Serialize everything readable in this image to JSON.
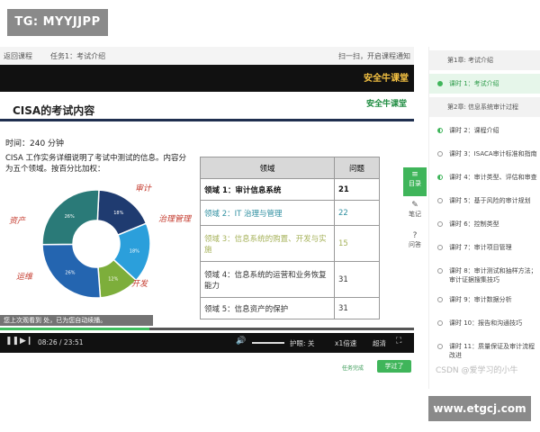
{
  "watermarks": {
    "top": "TG: MYYJJPP",
    "bottom": "www.etgcj.com",
    "csdn": "CSDN @爱学习的小牛"
  },
  "topbar": {
    "back": "返回课程",
    "task": "任务1：考试介绍",
    "scan": "扫一扫，开启课程通知"
  },
  "video": {
    "logo": "安全牛课堂",
    "slide": {
      "title": "CISA的考试内容",
      "logo": "安全牛课堂",
      "duration": "时间：240 分钟",
      "description": "CISA 工作实务详细说明了考试中测试的信息。内容分为五个领域。按百分比加权：",
      "donut": {
        "slices": [
          {
            "label": "18%",
            "value": 18,
            "color": "#1f3b70"
          },
          {
            "label": "18%",
            "value": 18,
            "color": "#2b9fdb"
          },
          {
            "label": "12%",
            "value": 12,
            "color": "#7dae3b"
          },
          {
            "label": "26%",
            "value": 26,
            "color": "#2465b0"
          },
          {
            "label": "26%",
            "value": 26,
            "color": "#2a7a78"
          }
        ]
      },
      "handwriting": [
        "审计",
        "治理管理",
        "开发",
        "运维",
        "资产"
      ],
      "table": {
        "headers": [
          "领域",
          "问题"
        ],
        "rows": [
          {
            "domain": "领域 1：审计信息系统",
            "count": "21"
          },
          {
            "domain": "领域 2：IT 治理与管理",
            "count": "22"
          },
          {
            "domain": "领域 3：信息系统的购置、开发与实施",
            "count": "15"
          },
          {
            "domain": "领域 4：信息系统的运营和业务恢复能力",
            "count": "31"
          },
          {
            "domain": "领域 5：信息资产的保护",
            "count": "31"
          }
        ]
      }
    },
    "resume_text": "您上次观看到 处，已为您自动续播。",
    "controls": {
      "time": "08:26 / 23:51",
      "progress": 0.36,
      "danmaku": "护眼: 关",
      "speed": "x1倍速",
      "quality": "超清"
    }
  },
  "below": {
    "done_badge": "任务完成",
    "learn_button": "学过了"
  },
  "tools": [
    {
      "label": "目录"
    },
    {
      "label": "笔记"
    },
    {
      "label": "问答"
    }
  ],
  "sidebar": {
    "items": [
      {
        "type": "chapter",
        "label": "第1章: 考试介绍"
      },
      {
        "type": "lesson",
        "label": "课时 1：考试介绍",
        "state": "current"
      },
      {
        "type": "chapter",
        "label": "第2章: 信息系统审计过程"
      },
      {
        "type": "lesson",
        "label": "课时 2：课程介绍",
        "state": "half"
      },
      {
        "type": "lesson",
        "label": "课时 3：ISACA审计标准和指南",
        "state": "none"
      },
      {
        "type": "lesson",
        "label": "课时 4：审计类型、评估和审查",
        "state": "half"
      },
      {
        "type": "lesson",
        "label": "课时 5：基于风险的审计规划",
        "state": "none"
      },
      {
        "type": "lesson",
        "label": "课时 6：控制类型",
        "state": "none"
      },
      {
        "type": "lesson",
        "label": "课时 7：审计项目管理",
        "state": "none"
      },
      {
        "type": "lesson",
        "label": "课时 8：审计测试和抽样方法；审计证据搜集技巧",
        "state": "none"
      },
      {
        "type": "lesson",
        "label": "课时 9：审计数据分析",
        "state": "none"
      },
      {
        "type": "lesson",
        "label": "课时 10：报告和沟通技巧",
        "state": "none"
      },
      {
        "type": "lesson",
        "label": "课时 11：质量保证及审计流程改进",
        "state": "none"
      }
    ]
  }
}
